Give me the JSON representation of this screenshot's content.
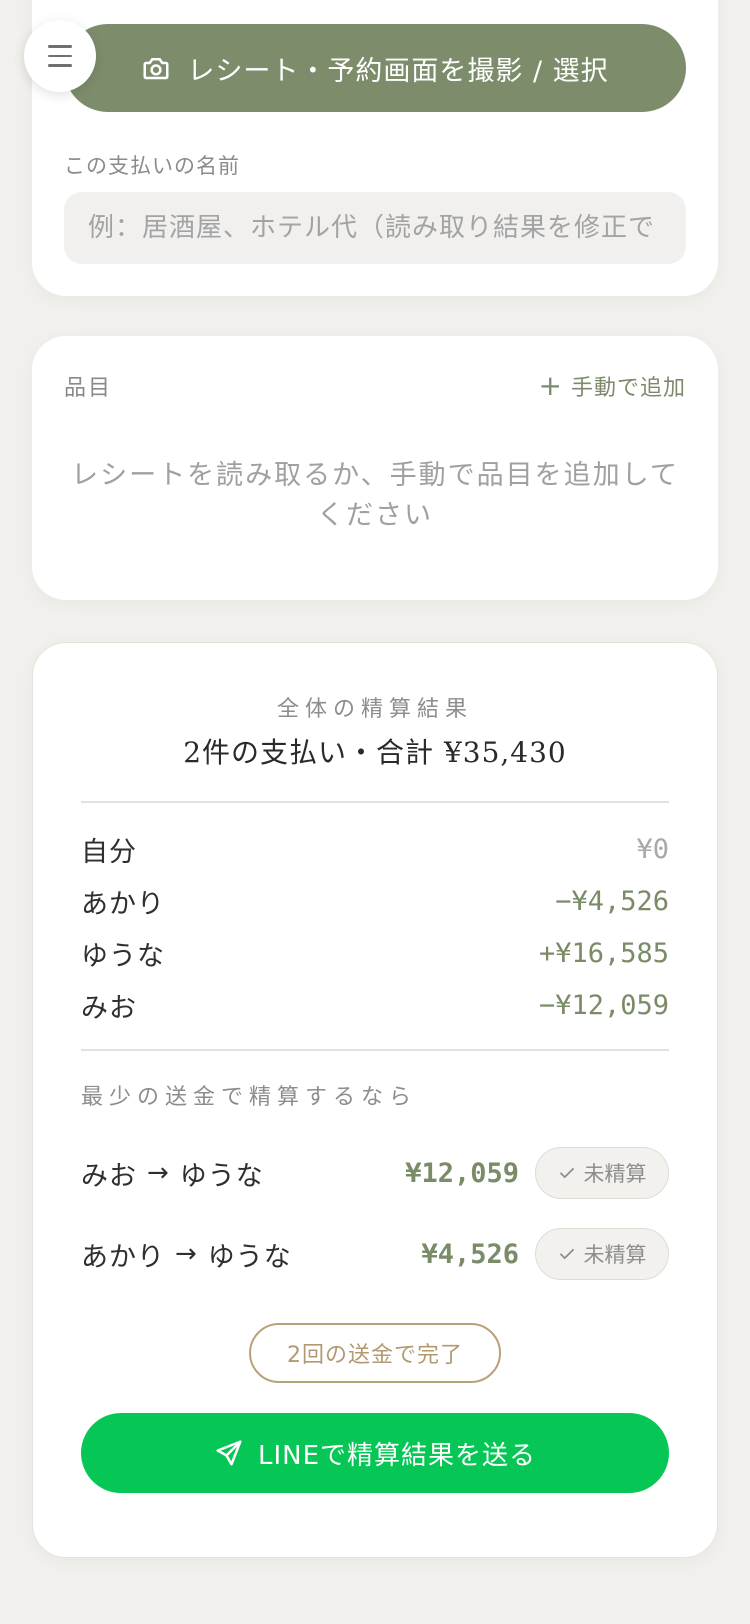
{
  "menu": {
    "icon": "hamburger-menu-icon"
  },
  "scan": {
    "label": "レシート・予約画面を撮影 / 選択",
    "icon": "camera-icon"
  },
  "payment_name": {
    "label": "この支払いの名前",
    "placeholder": "例：居酒屋、ホテル代（読み取り結果を修正で",
    "value": ""
  },
  "items": {
    "title": "品目",
    "add_label": "手動で追加",
    "add_icon": "plus-icon",
    "empty_message": "レシートを読み取るか、手動で品目を追加してください"
  },
  "summary": {
    "caption": "全体の精算結果",
    "total": "2件の支払い・合計 ¥35,430",
    "balances": [
      {
        "name": "自分",
        "amount": "¥0"
      },
      {
        "name": "あかり",
        "amount": "−¥4,526"
      },
      {
        "name": "ゆうな",
        "amount": "+¥16,585"
      },
      {
        "name": "みお",
        "amount": "−¥12,059"
      }
    ],
    "transfer_caption": "最少の送金で精算するなら",
    "transfers": [
      {
        "from": "みお",
        "to": "ゆうな",
        "amount": "¥12,059",
        "status": "未精算"
      },
      {
        "from": "あかり",
        "to": "ゆうな",
        "amount": "¥4,526",
        "status": "未精算"
      }
    ],
    "arrow": "→",
    "done_badge": "2回の送金で完了",
    "line_button": "LINEで精算結果を送る",
    "line_icon": "send-icon"
  },
  "colors": {
    "accent_green": "#7d8d6c",
    "line_green": "#06c755",
    "gold": "#b19a72",
    "background": "#f2f0ec"
  }
}
